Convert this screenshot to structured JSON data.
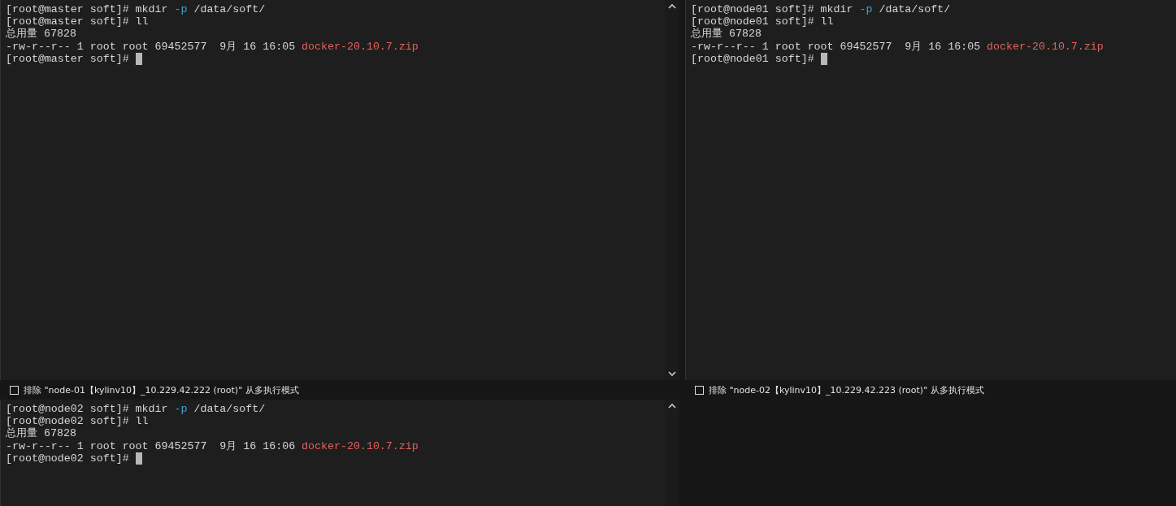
{
  "panes": [
    {
      "lines": [
        {
          "cursor": false,
          "segments": [
            {
              "kind": "plain",
              "text": "[root@master soft]# mkdir "
            },
            {
              "kind": "option",
              "text": "-p"
            },
            {
              "kind": "plain",
              "text": " /data/soft/"
            }
          ]
        },
        {
          "cursor": false,
          "segments": [
            {
              "kind": "plain",
              "text": "[root@master soft]# ll"
            }
          ]
        },
        {
          "cursor": false,
          "segments": [
            {
              "kind": "plain",
              "text": "总用量 67828"
            }
          ]
        },
        {
          "cursor": false,
          "segments": [
            {
              "kind": "plain",
              "text": "-rw-r--r-- 1 root root 69452577  9月 16 16:05 "
            },
            {
              "kind": "file",
              "text": "docker-20.10.7.zip"
            }
          ]
        },
        {
          "cursor": true,
          "segments": [
            {
              "kind": "plain",
              "text": "[root@master soft]# "
            }
          ]
        }
      ],
      "exclude": {
        "checked": false,
        "label": "排除 \"node-01【kylinv10】_10.229.42.222 (root)\" 从多执行模式"
      }
    },
    {
      "lines": [
        {
          "cursor": false,
          "segments": [
            {
              "kind": "plain",
              "text": "[root@node01 soft]# mkdir "
            },
            {
              "kind": "option",
              "text": "-p"
            },
            {
              "kind": "plain",
              "text": " /data/soft/"
            }
          ]
        },
        {
          "cursor": false,
          "segments": [
            {
              "kind": "plain",
              "text": "[root@node01 soft]# ll"
            }
          ]
        },
        {
          "cursor": false,
          "segments": [
            {
              "kind": "plain",
              "text": "总用量 67828"
            }
          ]
        },
        {
          "cursor": false,
          "segments": [
            {
              "kind": "plain",
              "text": "-rw-r--r-- 1 root root 69452577  9月 16 16:05 "
            },
            {
              "kind": "file",
              "text": "docker-20.10.7.zip"
            }
          ]
        },
        {
          "cursor": true,
          "segments": [
            {
              "kind": "plain",
              "text": "[root@node01 soft]# "
            }
          ]
        }
      ],
      "exclude": {
        "checked": false,
        "label": "排除 \"node-02【kylinv10】_10.229.42.223 (root)\" 从多执行模式"
      }
    },
    {
      "lines": [
        {
          "cursor": false,
          "segments": [
            {
              "kind": "plain",
              "text": "[root@node02 soft]# mkdir "
            },
            {
              "kind": "option",
              "text": "-p"
            },
            {
              "kind": "plain",
              "text": " /data/soft/"
            }
          ]
        },
        {
          "cursor": false,
          "segments": [
            {
              "kind": "plain",
              "text": "[root@node02 soft]# ll"
            }
          ]
        },
        {
          "cursor": false,
          "segments": [
            {
              "kind": "plain",
              "text": "总用量 67828"
            }
          ]
        },
        {
          "cursor": false,
          "segments": [
            {
              "kind": "plain",
              "text": "-rw-r--r-- 1 root root 69452577  9月 16 16:06 "
            },
            {
              "kind": "file",
              "text": "docker-20.10.7.zip"
            }
          ]
        },
        {
          "cursor": true,
          "segments": [
            {
              "kind": "plain",
              "text": "[root@node02 soft]# "
            }
          ]
        }
      ]
    }
  ]
}
